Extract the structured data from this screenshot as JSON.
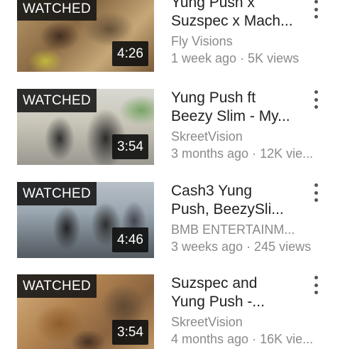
{
  "videos": [
    {
      "title_line1": "Yung Push x",
      "title_line2": "Suzspec x Mach...",
      "channel": "Fly Visions",
      "stats": "1 week ago · 5K views",
      "watched": "WATCHED",
      "duration": "4:26"
    },
    {
      "title_line1": "Yung Push ft",
      "title_line2": "Beezy Slim - My...",
      "channel": "SkreetVision",
      "stats": "3 months ago · 12K vie...",
      "watched": "WATCHED",
      "duration": "3:54"
    },
    {
      "title_line1": "Cash3 Yung",
      "title_line2": "Push, BeezySli...",
      "channel": "BMB ENTERTAINM...",
      "stats": "3 weeks ago · 245 views",
      "watched": "WATCHED",
      "duration": "4:46"
    },
    {
      "title_line1": "Suzspec and",
      "title_line2": "Yung Push -...",
      "channel": "SkreetVision",
      "stats": "4 months ago · 16K vie...",
      "watched": "WATCHED",
      "duration": "3:54"
    }
  ],
  "colors": {
    "background": "#ffffff",
    "title": "#222222",
    "secondary_text": "#8a8a8a",
    "overlay": "#141414"
  },
  "icons": {
    "menu": "more-vert-icon"
  }
}
